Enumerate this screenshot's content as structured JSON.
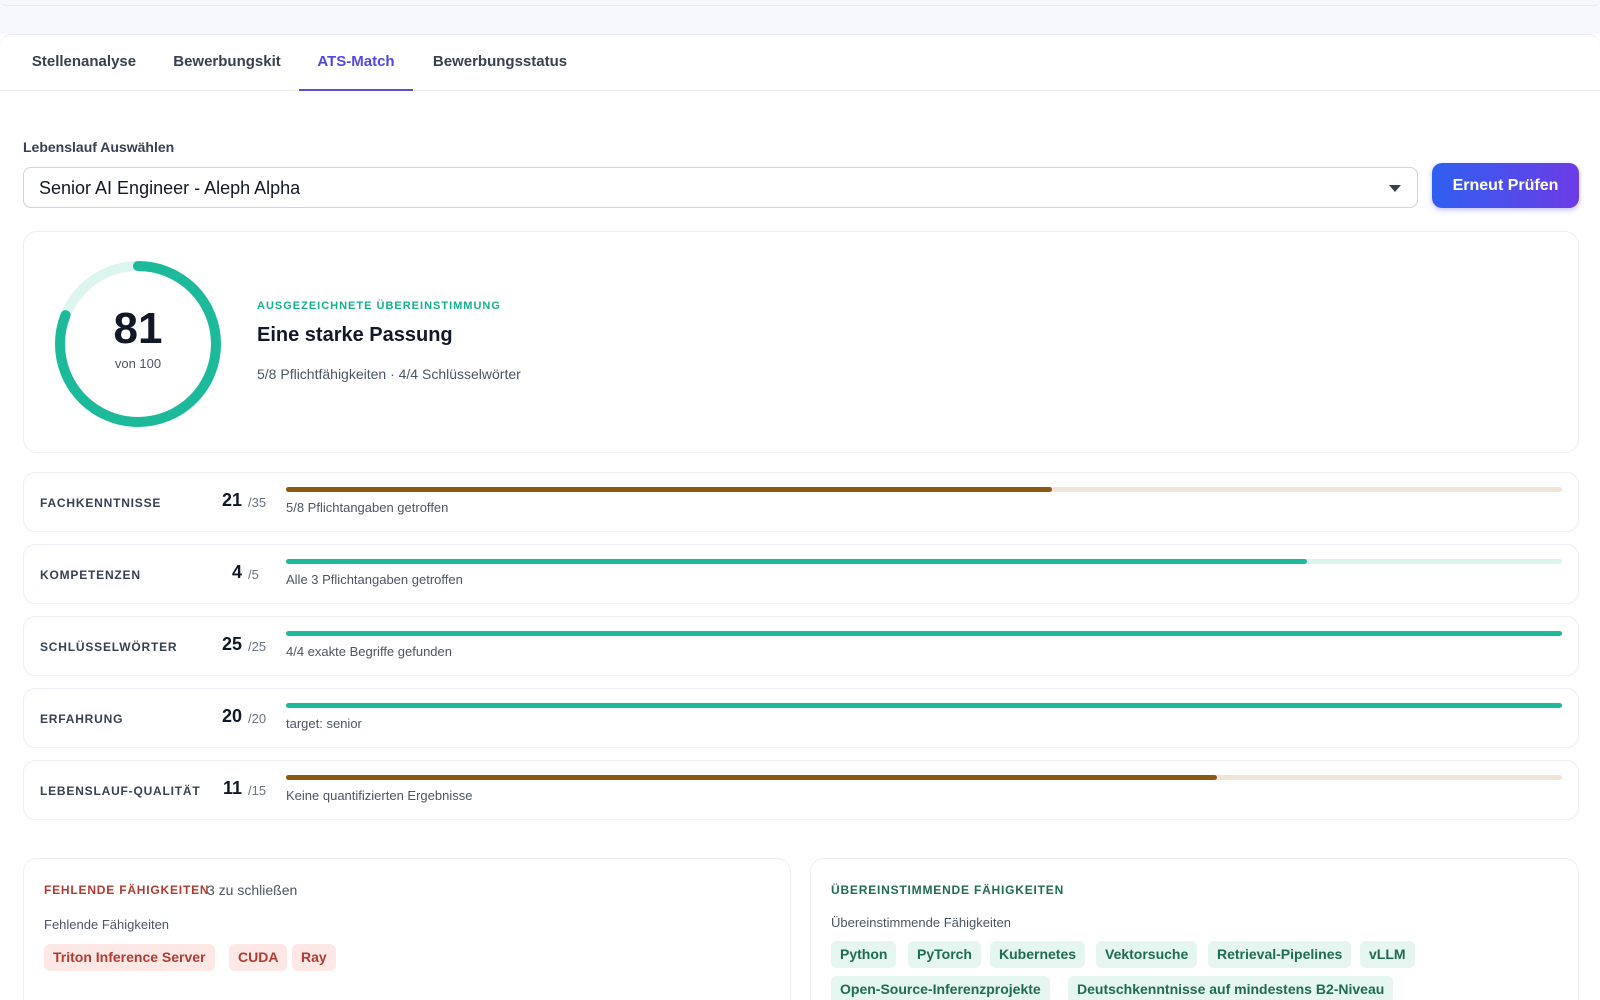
{
  "tabs": [
    {
      "label": "Stellenanalyse"
    },
    {
      "label": "Bewerbungskit"
    },
    {
      "label": "ATS-Match"
    },
    {
      "label": "Bewerbungsstatus"
    }
  ],
  "active_tab": "ATS-Match",
  "resume_select": {
    "label": "Lebenslauf Auswählen",
    "value": "Senior AI Engineer - Aleph Alpha"
  },
  "recheck_button": "Erneut Prüfen",
  "score": {
    "value": "81",
    "max_label": "von 100",
    "fraction": 0.81,
    "eyebrow": "AUSGEZEICHNETE ÜBEREINSTIMMUNG",
    "title": "Eine starke Passung",
    "meta": "5/8 Pflichtfähigkeiten · 4/4 Schlüsselwörter"
  },
  "metrics": [
    {
      "name": "FACHKENNTNISSE",
      "score": "21",
      "max": "/35",
      "fraction": 0.6,
      "status": "warn",
      "note": "5/8 Pflichtangaben getroffen"
    },
    {
      "name": "KOMPETENZEN",
      "score": "4",
      "max": "/5",
      "fraction": 0.8,
      "status": "ok",
      "note": "Alle 3 Pflichtangaben getroffen"
    },
    {
      "name": "SCHLÜSSELWÖRTER",
      "score": "25",
      "max": "/25",
      "fraction": 1.0,
      "status": "ok",
      "note": "4/4 exakte Begriffe gefunden"
    },
    {
      "name": "ERFAHRUNG",
      "score": "20",
      "max": "/20",
      "fraction": 1.0,
      "status": "ok",
      "note": "target: senior"
    },
    {
      "name": "LEBENSLAUF-QUALITÄT",
      "score": "11",
      "max": "/15",
      "fraction": 0.73,
      "status": "warn",
      "note": "Keine quantifizierten Ergebnisse"
    }
  ],
  "missing": {
    "heading": "FEHLENDE FÄHIGKEITEN",
    "count": "3 zu schließen",
    "sub": "Fehlende Fähigkeiten",
    "chips": [
      "Triton Inference Server",
      "CUDA",
      "Ray"
    ]
  },
  "matching": {
    "heading": "ÜBEREINSTIMMENDE FÄHIGKEITEN",
    "sub": "Übereinstimmende Fähigkeiten",
    "chips": [
      "Python",
      "PyTorch",
      "Kubernetes",
      "Vektorsuche",
      "Retrieval-Pipelines",
      "vLLM",
      "Open-Source-Inferenzprojekte",
      "Deutschkenntnisse auf mindestens B2-Niveau"
    ]
  },
  "colors": {
    "accent": "#4f46e5",
    "success": "#1cb99a",
    "warning": "#8a5a10",
    "danger": "#b23a32"
  }
}
